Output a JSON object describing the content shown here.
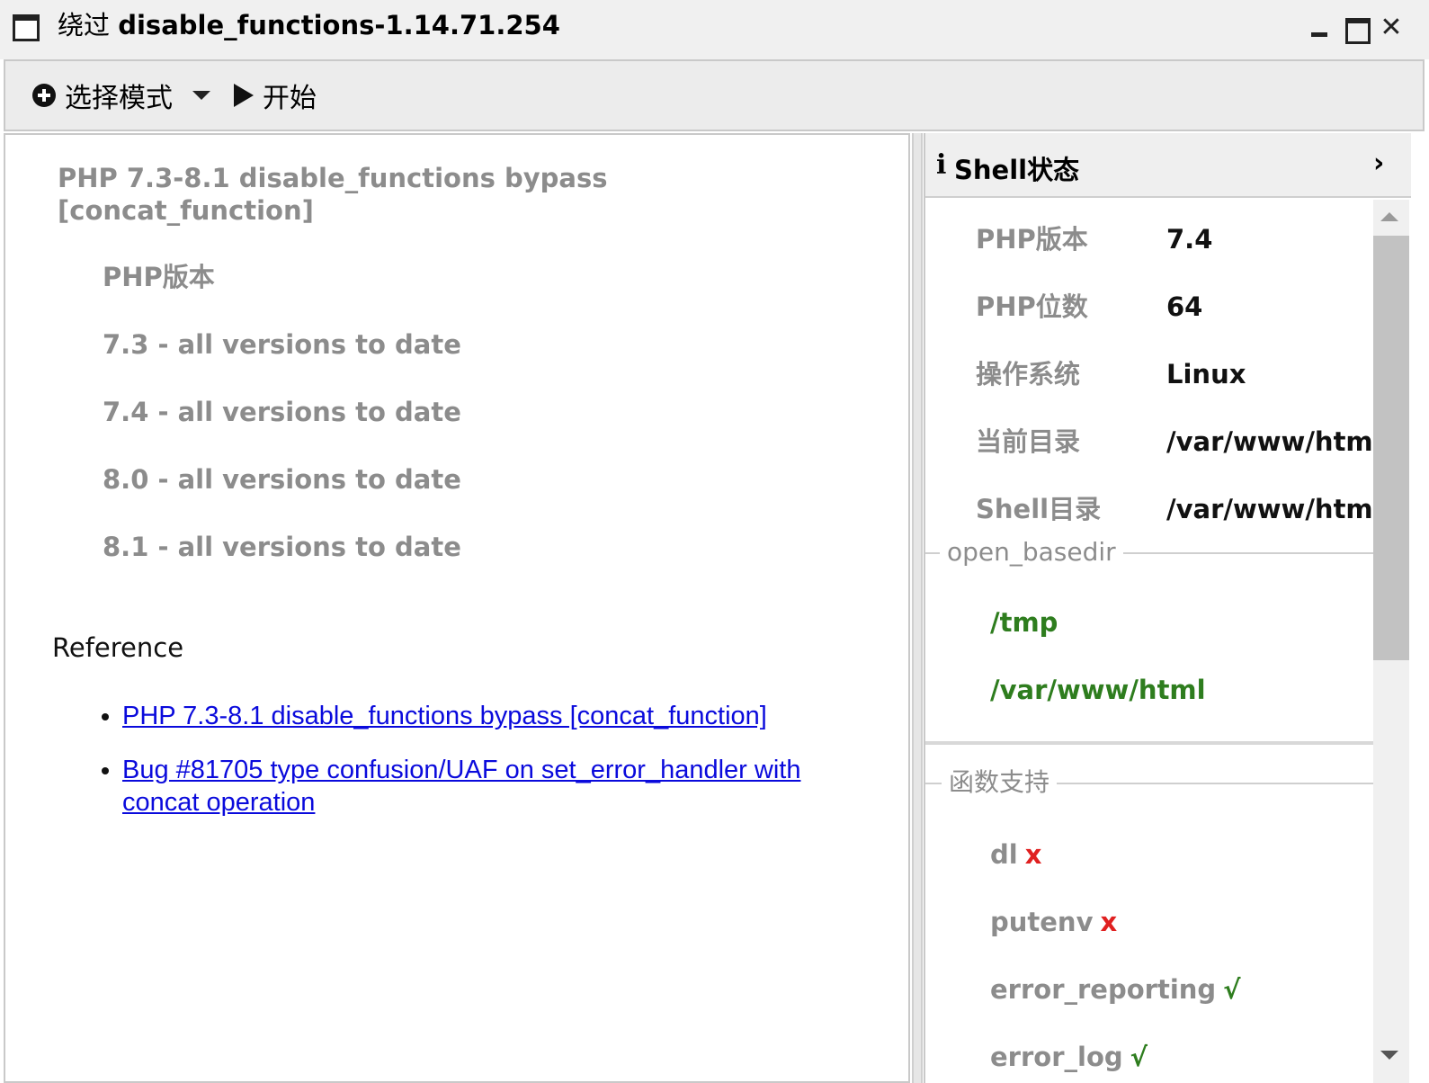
{
  "window": {
    "title_prefix": "绕过",
    "title_main": "disable_functions-1.14.71.254",
    "close_glyph": "✕"
  },
  "toolbar": {
    "mode_label": "选择模式",
    "start_label": "开始"
  },
  "left": {
    "title": "PHP 7.3-8.1 disable_functions bypass [concat_function]",
    "php_version_label": "PHP版本",
    "versions": [
      "7.3 - all versions to date",
      "7.4 - all versions to date",
      "8.0 - all versions to date",
      "8.1 - all versions to date"
    ],
    "reference_label": "Reference",
    "links": [
      "PHP 7.3-8.1 disable_functions bypass [concat_function]",
      "Bug #81705 type confusion/UAF on set_error_handler with concat operation"
    ]
  },
  "right": {
    "header": {
      "icon_glyph": "i",
      "title": "Shell状态",
      "chevron": "›"
    },
    "rows": [
      {
        "key": "PHP版本",
        "value": "7.4"
      },
      {
        "key": "PHP位数",
        "value": "64"
      },
      {
        "key": "操作系统",
        "value": "Linux"
      },
      {
        "key": "当前目录",
        "value": "/var/www/html"
      },
      {
        "key": "Shell目录",
        "value": "/var/www/html"
      }
    ],
    "open_basedir_label": "open_basedir",
    "open_basedir": [
      "/tmp",
      "/var/www/html"
    ],
    "functions_label": "函数支持",
    "functions": [
      {
        "name": "dl",
        "mark": "x"
      },
      {
        "name": "putenv",
        "mark": "x"
      },
      {
        "name": "error_reporting",
        "mark": "√"
      },
      {
        "name": "error_log",
        "mark": "√"
      }
    ]
  },
  "colors": {
    "label_gray": "#8c8c8c",
    "link_blue": "#0a0adc",
    "ok_green": "#2e7d1e",
    "fail_red": "#e02020"
  },
  "icons": [
    "window-icon",
    "minimize-icon",
    "maximize-icon",
    "close-icon",
    "plus-circle-icon",
    "chevron-down-icon",
    "play-icon",
    "info-icon",
    "chevron-right-icon",
    "scroll-up-icon",
    "scroll-down-icon"
  ]
}
